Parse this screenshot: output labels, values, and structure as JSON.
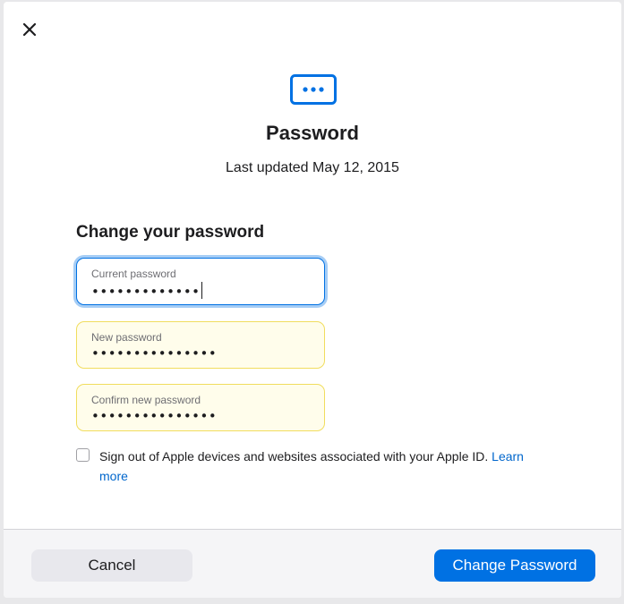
{
  "dialog": {
    "close_icon": "close-icon",
    "header_icon": "password-dots-icon",
    "title": "Password",
    "subtitle": "Last updated May 12, 2015",
    "accent_color": "#0071e3",
    "warning_color": "#f1dd5e"
  },
  "form": {
    "heading": "Change your password",
    "fields": [
      {
        "label": "Current password",
        "value": "•••••••••••••",
        "state": "focused"
      },
      {
        "label": "New password",
        "value": "•••••••••••••••",
        "state": "warning"
      },
      {
        "label": "Confirm new password",
        "value": "•••••••••••••••",
        "state": "warning"
      }
    ],
    "sign_out_checkbox": {
      "checked": false,
      "text": "Sign out of Apple devices and websites associated with your Apple ID.",
      "link": "Learn more"
    }
  },
  "footer": {
    "cancel_label": "Cancel",
    "submit_label": "Change Password"
  }
}
